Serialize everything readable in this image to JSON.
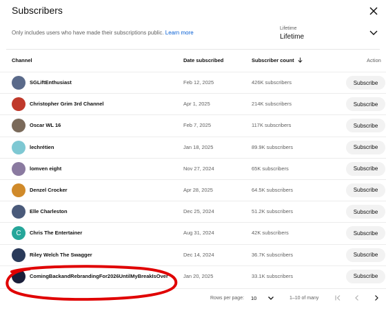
{
  "dialog": {
    "title": "Subscribers",
    "close_icon": "close-icon"
  },
  "notice": {
    "text": "Only includes users who have made their subscriptions public.",
    "link": "Learn more"
  },
  "period": {
    "label": "Lifetime",
    "value": "Lifetime"
  },
  "columns": {
    "channel": "Channel",
    "date": "Date subscribed",
    "count": "Subscriber count",
    "action": "Action"
  },
  "rows": [
    {
      "name": "SGLiftEnthusiast",
      "date": "Feb 12, 2025",
      "count": "426K subscribers",
      "button": "Subscribe",
      "avatar_color": "#5a6a8a"
    },
    {
      "name": "Christopher Grim 3rd Channel",
      "date": "Apr 1, 2025",
      "count": "214K subscribers",
      "button": "Subscribe",
      "avatar_color": "#c0392b"
    },
    {
      "name": "Oscar WL 16",
      "date": "Feb 7, 2025",
      "count": "117K subscribers",
      "button": "Subscribe",
      "avatar_color": "#7a6a5a"
    },
    {
      "name": "lechrétien",
      "date": "Jan 18, 2025",
      "count": "89.9K subscribers",
      "button": "Subscribe",
      "avatar_color": "#7ec8d3"
    },
    {
      "name": "lomven eight",
      "date": "Nov 27, 2024",
      "count": "65K subscribers",
      "button": "Subscribe",
      "avatar_color": "#8a7aa0"
    },
    {
      "name": "Denzel Crocker",
      "date": "Apr 28, 2025",
      "count": "64.5K subscribers",
      "button": "Subscribe",
      "avatar_color": "#d08a2a"
    },
    {
      "name": "Elle Charleston",
      "date": "Dec 25, 2024",
      "count": "51.2K subscribers",
      "button": "Subscribe",
      "avatar_color": "#4a5a7a"
    },
    {
      "name": "Chris The Entertainer",
      "date": "Aug 31, 2024",
      "count": "42K subscribers",
      "button": "Subscribe",
      "avatar_color": "#26a69a",
      "avatar_letter": "C"
    },
    {
      "name": "Riley Welch The Swagger",
      "date": "Dec 14, 2024",
      "count": "36.7K subscribers",
      "button": "Subscribe",
      "avatar_color": "#2a3a5a"
    },
    {
      "name": "ComingBackandRebrandingFor2026UntilMyBreakIsOver",
      "date": "Jan 20, 2025",
      "count": "33.1K subscribers",
      "button": "Subscribe",
      "avatar_color": "#1a1f3a"
    }
  ],
  "pagination": {
    "rows_per_page_label": "Rows per page:",
    "rows_per_page_value": "10",
    "range_text": "1–10 of many"
  },
  "colors": {
    "link": "#065fd4",
    "annotation": "#e00000",
    "button_bg": "#f2f2f2"
  }
}
